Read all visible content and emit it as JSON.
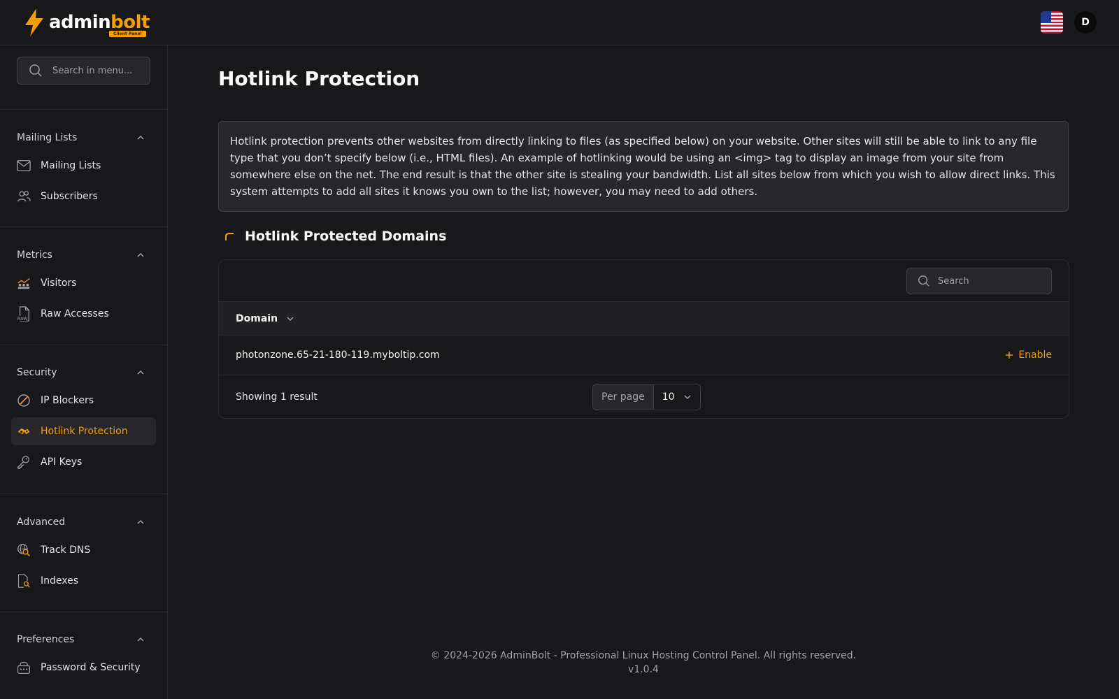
{
  "app": {
    "logo_admin": "admin",
    "logo_bolt": "bolt",
    "logo_badge": "Client Panel",
    "avatar_letter": "D",
    "language_flag": "us-flag-icon",
    "accent_color": "#f59e0b"
  },
  "sidebar": {
    "search_placeholder": "Search in menu...",
    "groups": [
      {
        "title": "Mailing Lists",
        "items": [
          {
            "label": "Mailing Lists",
            "icon": "envelope-icon"
          },
          {
            "label": "Subscribers",
            "icon": "users-icon"
          }
        ]
      },
      {
        "title": "Metrics",
        "items": [
          {
            "label": "Visitors",
            "icon": "visitors-icon"
          },
          {
            "label": "Raw Accesses",
            "icon": "raw-file-icon"
          }
        ]
      },
      {
        "title": "Security",
        "items": [
          {
            "label": "IP Blockers",
            "icon": "block-icon"
          },
          {
            "label": "Hotlink Protection",
            "icon": "hotlink-icon",
            "active": true
          },
          {
            "label": "API Keys",
            "icon": "key-icon"
          }
        ]
      },
      {
        "title": "Advanced",
        "items": [
          {
            "label": "Track DNS",
            "icon": "dns-search-icon"
          },
          {
            "label": "Indexes",
            "icon": "file-search-icon"
          }
        ]
      },
      {
        "title": "Preferences",
        "items": [
          {
            "label": "Password & Security",
            "icon": "lock-icon"
          }
        ]
      }
    ]
  },
  "main": {
    "title": "Hotlink Protection",
    "info": "Hotlink protection prevents other websites from directly linking to files (as specified below) on your website. Other sites will still be able to link to any file type that you don’t specify below (i.e., HTML files). An example of hotlinking would be using an <img> tag to display an image from your site from somewhere else on the net. The end result is that the other site is stealing your bandwidth. List all sites below from which you wish to allow direct links. This system attempts to add all sites it knows you own to the list; however, you may need to add others.",
    "section_title": "Hotlink Protected Domains",
    "table": {
      "search_placeholder": "Search",
      "column_domain": "Domain",
      "rows": [
        {
          "domain": "photonzone.65-21-180-119.myboltip.com",
          "action": "Enable"
        }
      ],
      "showing": "Showing 1 result",
      "per_page_label": "Per page",
      "per_page_value": "10"
    }
  },
  "footer": {
    "copyright": "© 2024-2026 AdminBolt - Professional Linux Hosting Control Panel. All rights reserved.",
    "version": "v1.0.4"
  }
}
